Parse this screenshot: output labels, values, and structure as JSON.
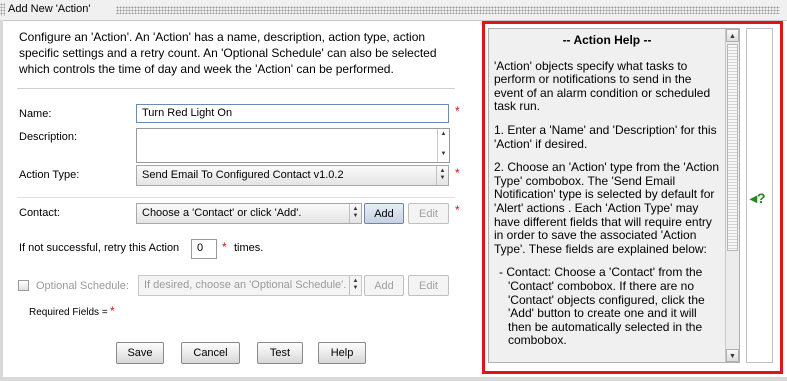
{
  "window": {
    "title": "Add New 'Action'"
  },
  "description": "Configure an 'Action'. An 'Action' has a name, description, action type, action specific settings and a retry count. An 'Optional Schedule' can also be selected which controls the time of day and week the 'Action' can be performed.",
  "form": {
    "name_label": "Name:",
    "name_value": "Turn Red Light On",
    "description_label": "Description:",
    "description_value": "",
    "action_type_label": "Action Type:",
    "action_type_value": "Send Email To Configured Contact v1.0.2",
    "contact_label": "Contact:",
    "contact_value": "Choose a 'Contact' or click 'Add'.",
    "contact_add": "Add",
    "contact_edit": "Edit",
    "retry_prefix": "If not successful, retry this Action",
    "retry_value": "0",
    "retry_suffix": "times.",
    "schedule_label": "Optional Schedule:",
    "schedule_value": "If desired, choose an 'Optional Schedule'.",
    "schedule_add": "Add",
    "schedule_edit": "Edit",
    "required_label": "Required Fields =",
    "required_marker": "*"
  },
  "buttons": {
    "save": "Save",
    "cancel": "Cancel",
    "test": "Test",
    "help": "Help"
  },
  "help": {
    "title": "--  Action Help  --",
    "p1": "'Action' objects specify what tasks to perform or notifications to send in the event of an alarm condition or scheduled task run.",
    "p2": "1. Enter a 'Name' and 'Description' for this 'Action' if desired.",
    "p3": "2. Choose an 'Action' type from the 'Action Type' combobox. The 'Send Email Notification' type is selected by default for 'Alert' actions . Each 'Action Type' may have different fields that will require entry in order to save the associated 'Action Type'. These fields are explained below:",
    "p4": "- Contact: Choose a 'Contact' from the 'Contact' combobox. If there are no 'Contact' objects configured, click the 'Add' button to create one and it will then be automatically selected in the combobox.",
    "toggle": "◂?"
  },
  "colors": {
    "highlight": "#e01515",
    "required": "#e01010",
    "help_toggle": "#1f8a1f"
  }
}
